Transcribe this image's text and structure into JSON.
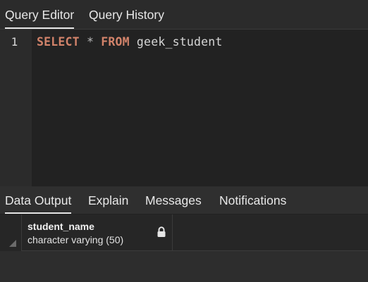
{
  "query_tabs": [
    {
      "label": "Query Editor",
      "active": true
    },
    {
      "label": "Query History",
      "active": false
    }
  ],
  "editor": {
    "line_number": "1",
    "tokens": {
      "select": "SELECT",
      "star": "*",
      "from": "FROM",
      "table": "geek_student"
    }
  },
  "output_tabs": [
    {
      "label": "Data Output",
      "active": true
    },
    {
      "label": "Explain",
      "active": false
    },
    {
      "label": "Messages",
      "active": false
    },
    {
      "label": "Notifications",
      "active": false
    }
  ],
  "result_grid": {
    "columns": [
      {
        "name": "student_name",
        "type": "character varying (50)",
        "icon": "lock-icon"
      }
    ]
  },
  "colors": {
    "keyword": "#d2836a",
    "editor_bg": "#222222",
    "panel_bg": "#2d2d2d"
  }
}
